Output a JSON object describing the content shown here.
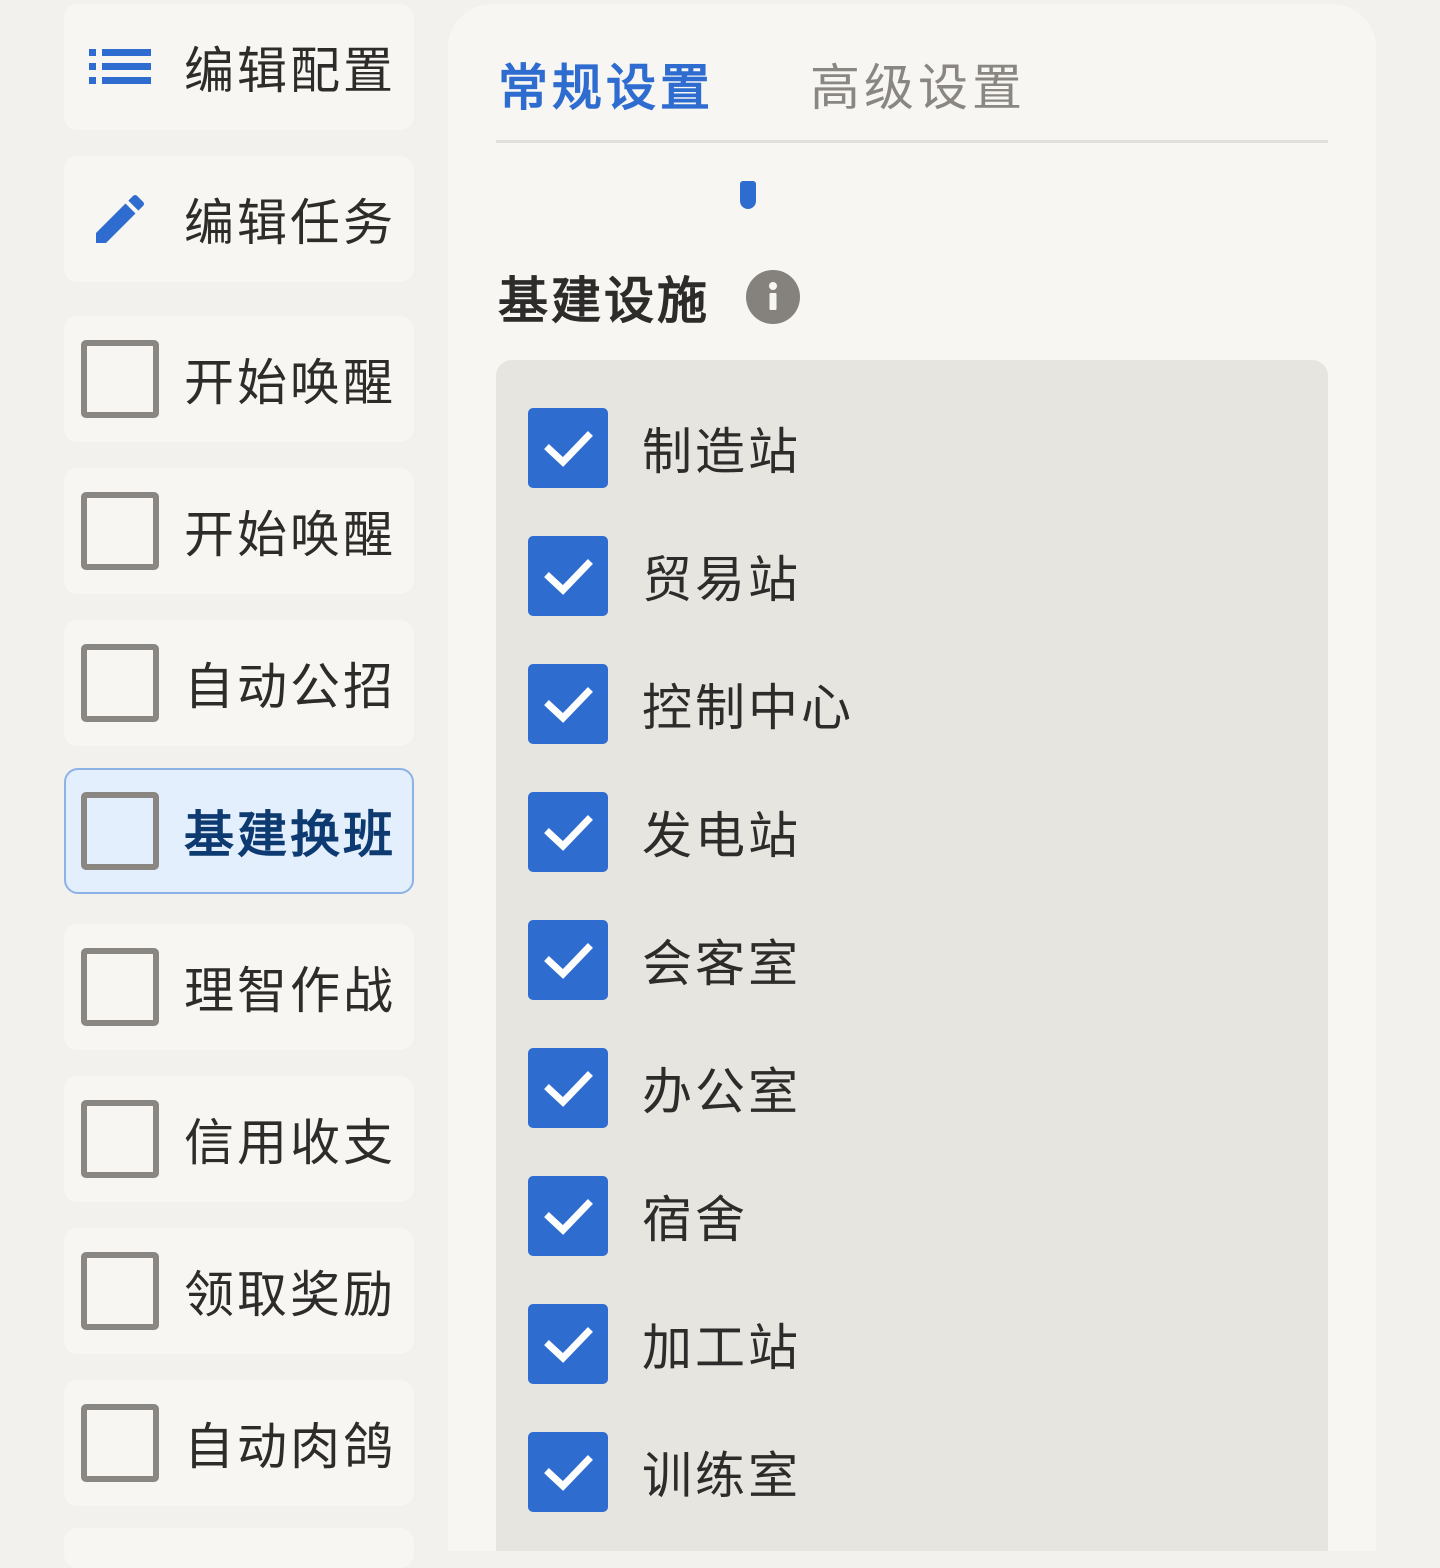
{
  "colors": {
    "accent": "#2e6dcf",
    "selected_bg": "#e3effd",
    "selected_border": "#8db2e6",
    "checkbox_border": "#8a8682",
    "panel_bg": "#f7f6f3",
    "facility_box_bg": "#e7e5e0"
  },
  "sidebar": {
    "edit_config": {
      "label": "编辑配置",
      "icon": "list-icon"
    },
    "edit_tasks": {
      "label": "编辑任务",
      "icon": "pencil-icon"
    },
    "tasks": [
      {
        "label": "开始唤醒",
        "checked": false,
        "selected": false
      },
      {
        "label": "开始唤醒",
        "checked": false,
        "selected": false
      },
      {
        "label": "自动公招",
        "checked": false,
        "selected": false
      },
      {
        "label": "基建换班",
        "checked": false,
        "selected": true
      },
      {
        "label": "理智作战",
        "checked": false,
        "selected": false
      },
      {
        "label": "信用收支",
        "checked": false,
        "selected": false
      },
      {
        "label": "领取奖励",
        "checked": false,
        "selected": false
      },
      {
        "label": "自动肉鸽",
        "checked": false,
        "selected": false
      }
    ]
  },
  "settings": {
    "tabs": [
      {
        "label": "常规设置",
        "active": true
      },
      {
        "label": "高级设置",
        "active": false
      }
    ],
    "section_title": "基建设施",
    "info_icon": "info-icon",
    "facilities": [
      {
        "label": "制造站",
        "checked": true
      },
      {
        "label": "贸易站",
        "checked": true
      },
      {
        "label": "控制中心",
        "checked": true
      },
      {
        "label": "发电站",
        "checked": true
      },
      {
        "label": "会客室",
        "checked": true
      },
      {
        "label": "办公室",
        "checked": true
      },
      {
        "label": "宿舍",
        "checked": true
      },
      {
        "label": "加工站",
        "checked": true
      },
      {
        "label": "训练室",
        "checked": true
      }
    ]
  }
}
